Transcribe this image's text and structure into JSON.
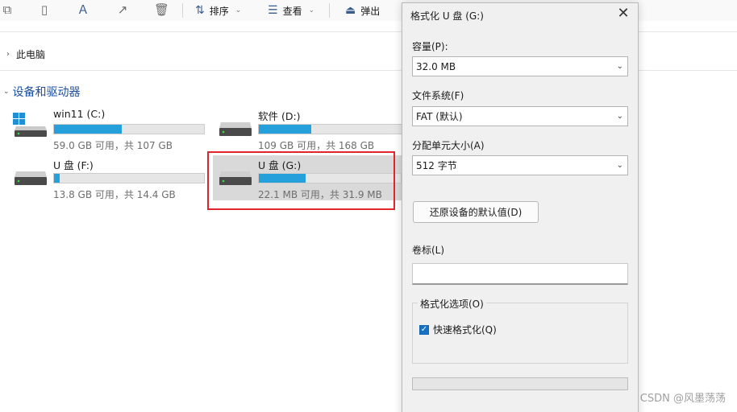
{
  "toolbar": {
    "sort_label": "排序",
    "view_label": "查看",
    "eject_label": "弹出"
  },
  "address": {
    "text": "此电脑"
  },
  "section": {
    "title": "设备和驱动器"
  },
  "drives": [
    {
      "name": "win11 (C:)",
      "info": "59.0 GB 可用，共 107 GB",
      "used_fraction": 0.45,
      "icon": "windows-drive-icon"
    },
    {
      "name": "软件 (D:)",
      "info": "109 GB 可用，共 168 GB",
      "used_fraction": 0.35,
      "icon": "drive-icon"
    },
    {
      "name": "U 盘 (F:)",
      "info": "13.8 GB 可用，共 14.4 GB",
      "used_fraction": 0.04,
      "icon": "drive-icon"
    },
    {
      "name": "U 盘 (G:)",
      "info": "22.1 MB 可用，共 31.9 MB",
      "used_fraction": 0.31,
      "icon": "drive-icon"
    }
  ],
  "dialog": {
    "title": "格式化 U 盘 (G:)",
    "capacity_label": "容量(P):",
    "capacity_value": "32.0 MB",
    "filesystem_label": "文件系统(F)",
    "filesystem_value": "FAT (默认)",
    "allocation_label": "分配单元大小(A)",
    "allocation_value": "512 字节",
    "restore_button": "还原设备的默认值(D)",
    "volume_label": "卷标(L)",
    "volume_value": "",
    "options_label": "格式化选项(O)",
    "quick_format_label": "快速格式化(Q)",
    "quick_format_checked": true
  },
  "watermark": "CSDN @风墨荡荡"
}
